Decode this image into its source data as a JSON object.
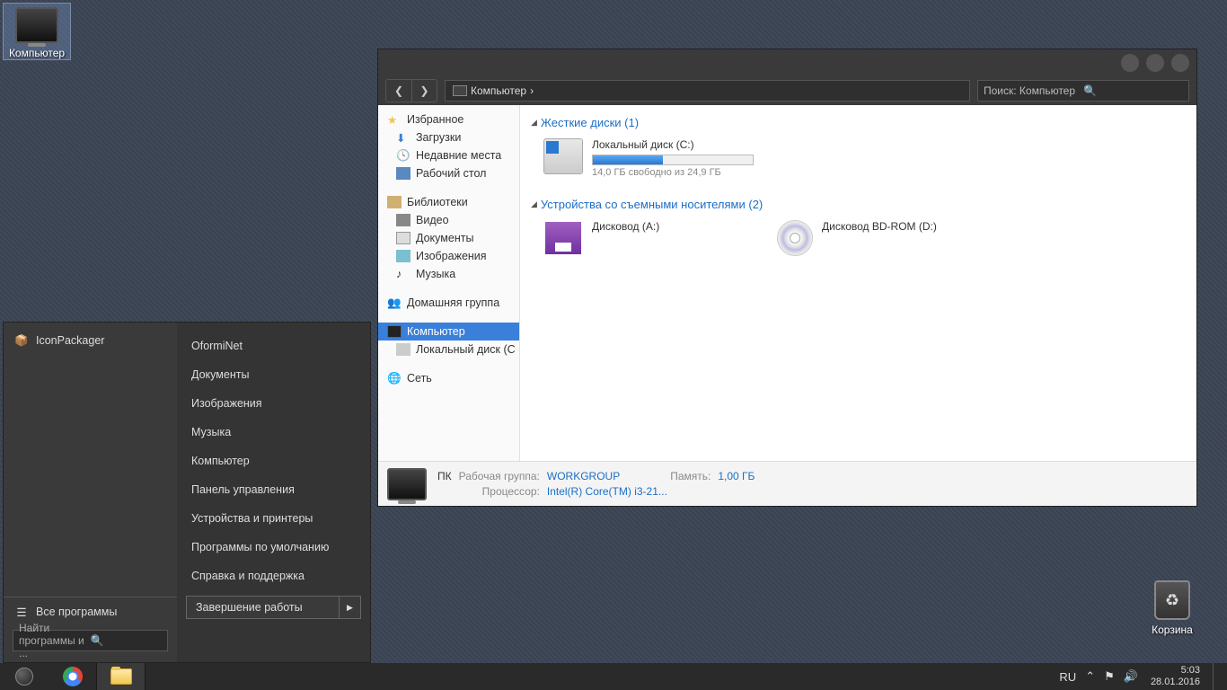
{
  "desktop": {
    "computer_label": "Компьютер",
    "recycle_label": "Корзина"
  },
  "start_menu": {
    "left": {
      "iconpackager": "IconPackager",
      "all_programs": "Все программы",
      "search_placeholder": "Найти программы и ..."
    },
    "right": {
      "items": [
        "OformiNet",
        "Документы",
        "Изображения",
        "Музыка",
        "Компьютер",
        "Панель управления",
        "Устройства и принтеры",
        "Программы по умолчанию",
        "Справка и поддержка"
      ],
      "shutdown": "Завершение работы"
    }
  },
  "explorer": {
    "address": {
      "location": "Компьютер",
      "sep": "›"
    },
    "search_placeholder": "Поиск: Компьютер",
    "sidebar": {
      "favorites": "Избранное",
      "downloads": "Загрузки",
      "recent": "Недавние места",
      "desktop": "Рабочий стол",
      "libraries": "Библиотеки",
      "videos": "Видео",
      "documents": "Документы",
      "pictures": "Изображения",
      "music": "Музыка",
      "homegroup": "Домашняя группа",
      "computer": "Компьютер",
      "local_disk": "Локальный диск (C",
      "network": "Сеть"
    },
    "groups": {
      "hdd": "Жесткие диски (1)",
      "removable": "Устройства со съемными носителями (2)"
    },
    "drives": {
      "c": {
        "name": "Локальный диск (C:)",
        "free": "14,0 ГБ свободно из 24,9 ГБ",
        "fill_pct": 44
      },
      "a": {
        "name": "Дисковод (A:)"
      },
      "d": {
        "name": "Дисковод BD-ROM (D:)"
      }
    },
    "details": {
      "pc": "ПК",
      "workgroup_lbl": "Рабочая группа:",
      "workgroup_val": "WORKGROUP",
      "memory_lbl": "Память:",
      "memory_val": "1,00 ГБ",
      "cpu_lbl": "Процессор:",
      "cpu_val": "Intel(R) Core(TM) i3-21..."
    }
  },
  "taskbar": {
    "lang": "RU",
    "time": "5:03",
    "date": "28.01.2016"
  }
}
